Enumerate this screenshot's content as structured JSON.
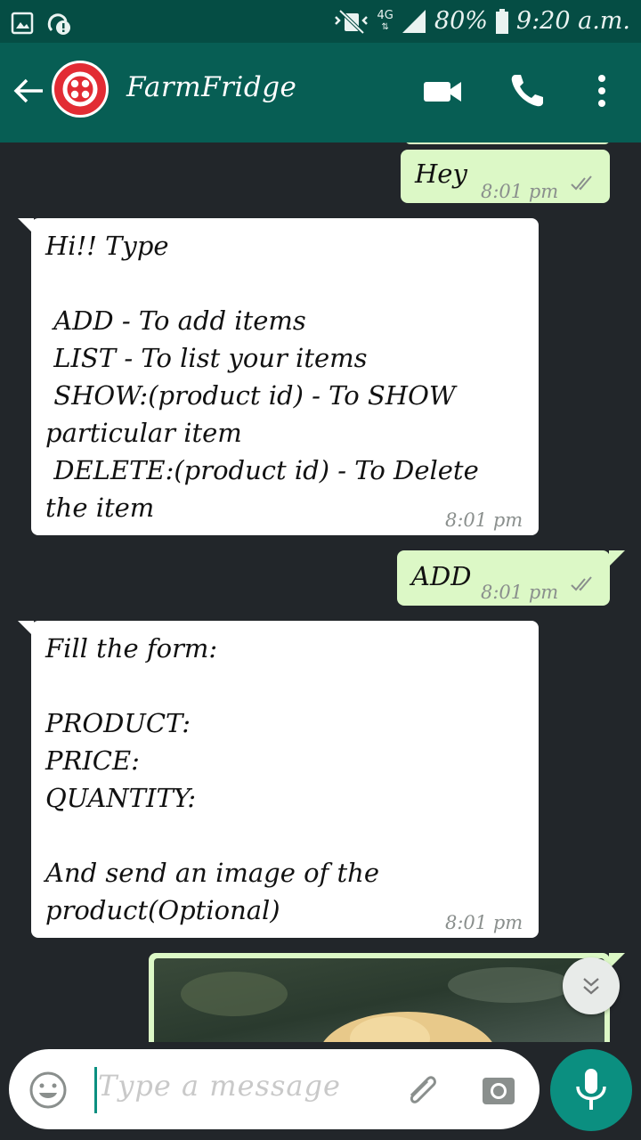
{
  "status_bar": {
    "network": "4G",
    "battery": "80%",
    "time": "9:20 a.m."
  },
  "header": {
    "contact_name": "FarmFridge"
  },
  "messages": [
    {
      "direction": "outgoing",
      "text": "Hey",
      "time": "8:01 pm",
      "status": "read"
    },
    {
      "direction": "incoming",
      "text": "Hi!! Type\n\n ADD - To add items\n LIST - To list your items\n SHOW:(product id) - To SHOW\nparticular item\n DELETE:(product id) - To Delete\nthe item",
      "time": "8:01 pm"
    },
    {
      "direction": "outgoing",
      "text": "ADD",
      "time": "8:01 pm",
      "status": "read"
    },
    {
      "direction": "incoming",
      "text": "Fill the form:\n\nPRODUCT:\nPRICE:\nQUANTITY:\n\nAnd send an image of the\nproduct(Optional)",
      "time": "8:01 pm"
    }
  ],
  "composer": {
    "placeholder": "Type a message"
  },
  "colors": {
    "header": "#075e54",
    "status_bar": "#054d44",
    "chat_background": "#22262a",
    "incoming_bubble": "#ffffff",
    "outgoing_bubble": "#dcf8c6",
    "accent": "#0b8f80",
    "avatar": "#e22c34",
    "read_ticks": "#8a8f8d"
  },
  "icons": {
    "back": "arrow-left-icon",
    "video_call": "video-camera-icon",
    "voice_call": "phone-icon",
    "menu": "more-vert-icon",
    "emoji": "smiley-icon",
    "attach": "paperclip-icon",
    "camera": "camera-icon",
    "mic": "microphone-icon",
    "scroll": "double-chevron-down-icon"
  }
}
